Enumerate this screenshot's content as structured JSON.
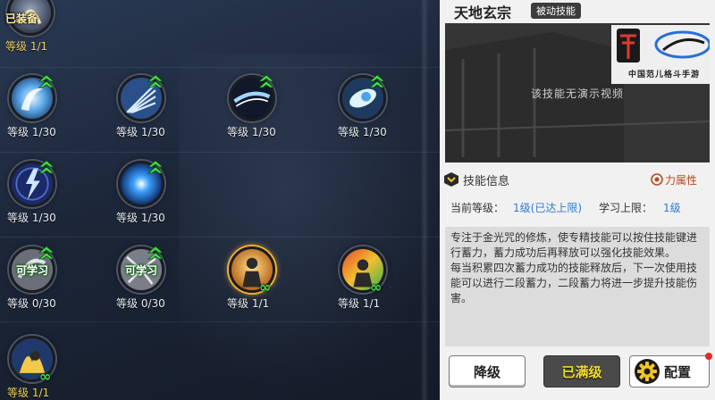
{
  "skills": [
    {
      "id": "s0",
      "equip_tag": "已装备",
      "level": "等级 1/1",
      "state": "equipped"
    },
    {
      "id": "s1",
      "level": "等级 1/30",
      "state": "upgradable"
    },
    {
      "id": "s2",
      "level": "等级 1/30",
      "state": "upgradable"
    },
    {
      "id": "s3",
      "level": "等级 1/30",
      "state": "upgradable"
    },
    {
      "id": "s4",
      "level": "等级 1/30",
      "state": "upgradable"
    },
    {
      "id": "s5",
      "level": "等级 1/30",
      "state": "upgradable"
    },
    {
      "id": "s6",
      "level": "等级 1/30",
      "state": "upgradable"
    },
    {
      "id": "s7",
      "learn_tag": "可学习",
      "level": "等级 0/30",
      "state": "learnable"
    },
    {
      "id": "s8",
      "learn_tag": "可学习",
      "level": "等级 0/30",
      "state": "learnable"
    },
    {
      "id": "s9",
      "level": "等级 1/1",
      "state": "maxed",
      "inf": "∞"
    },
    {
      "id": "s10",
      "level": "等级 1/1",
      "state": "maxed",
      "inf": "∞"
    },
    {
      "id": "s11",
      "level": "等级 1/1",
      "state": "maxed",
      "inf": "∞"
    }
  ],
  "detail": {
    "skill_name": "天地玄宗",
    "skill_type": "被动技能",
    "video_placeholder": "该技能无演示视频",
    "logo_subtitle": "中国范儿格斗手游",
    "info_title": "技能信息",
    "attribute_label": "力属性",
    "current_level_label": "当前等级：",
    "current_level_value": "1级(已达上限)",
    "max_level_label": "学习上限：",
    "max_level_value": "1级",
    "description_1": "专注于金光咒的修炼，使专精技能可以按住技能键进行蓄力，蓄力成功后再释放可以强化技能效果。",
    "description_2": "每当积累四次蓄力成功的技能释放后，下一次使用技能可以进行二段蓄力，二段蓄力将进一步提升技能伤害。"
  },
  "buttons": {
    "downgrade": "降级",
    "maxed": "已满级",
    "config": "配置"
  },
  "colors": {
    "accent_blue": "#2a7bd6",
    "maxed_yellow": "#f2dc2a",
    "upgrade_green": "#44e04c",
    "attribute_orange": "#b34a1e"
  }
}
